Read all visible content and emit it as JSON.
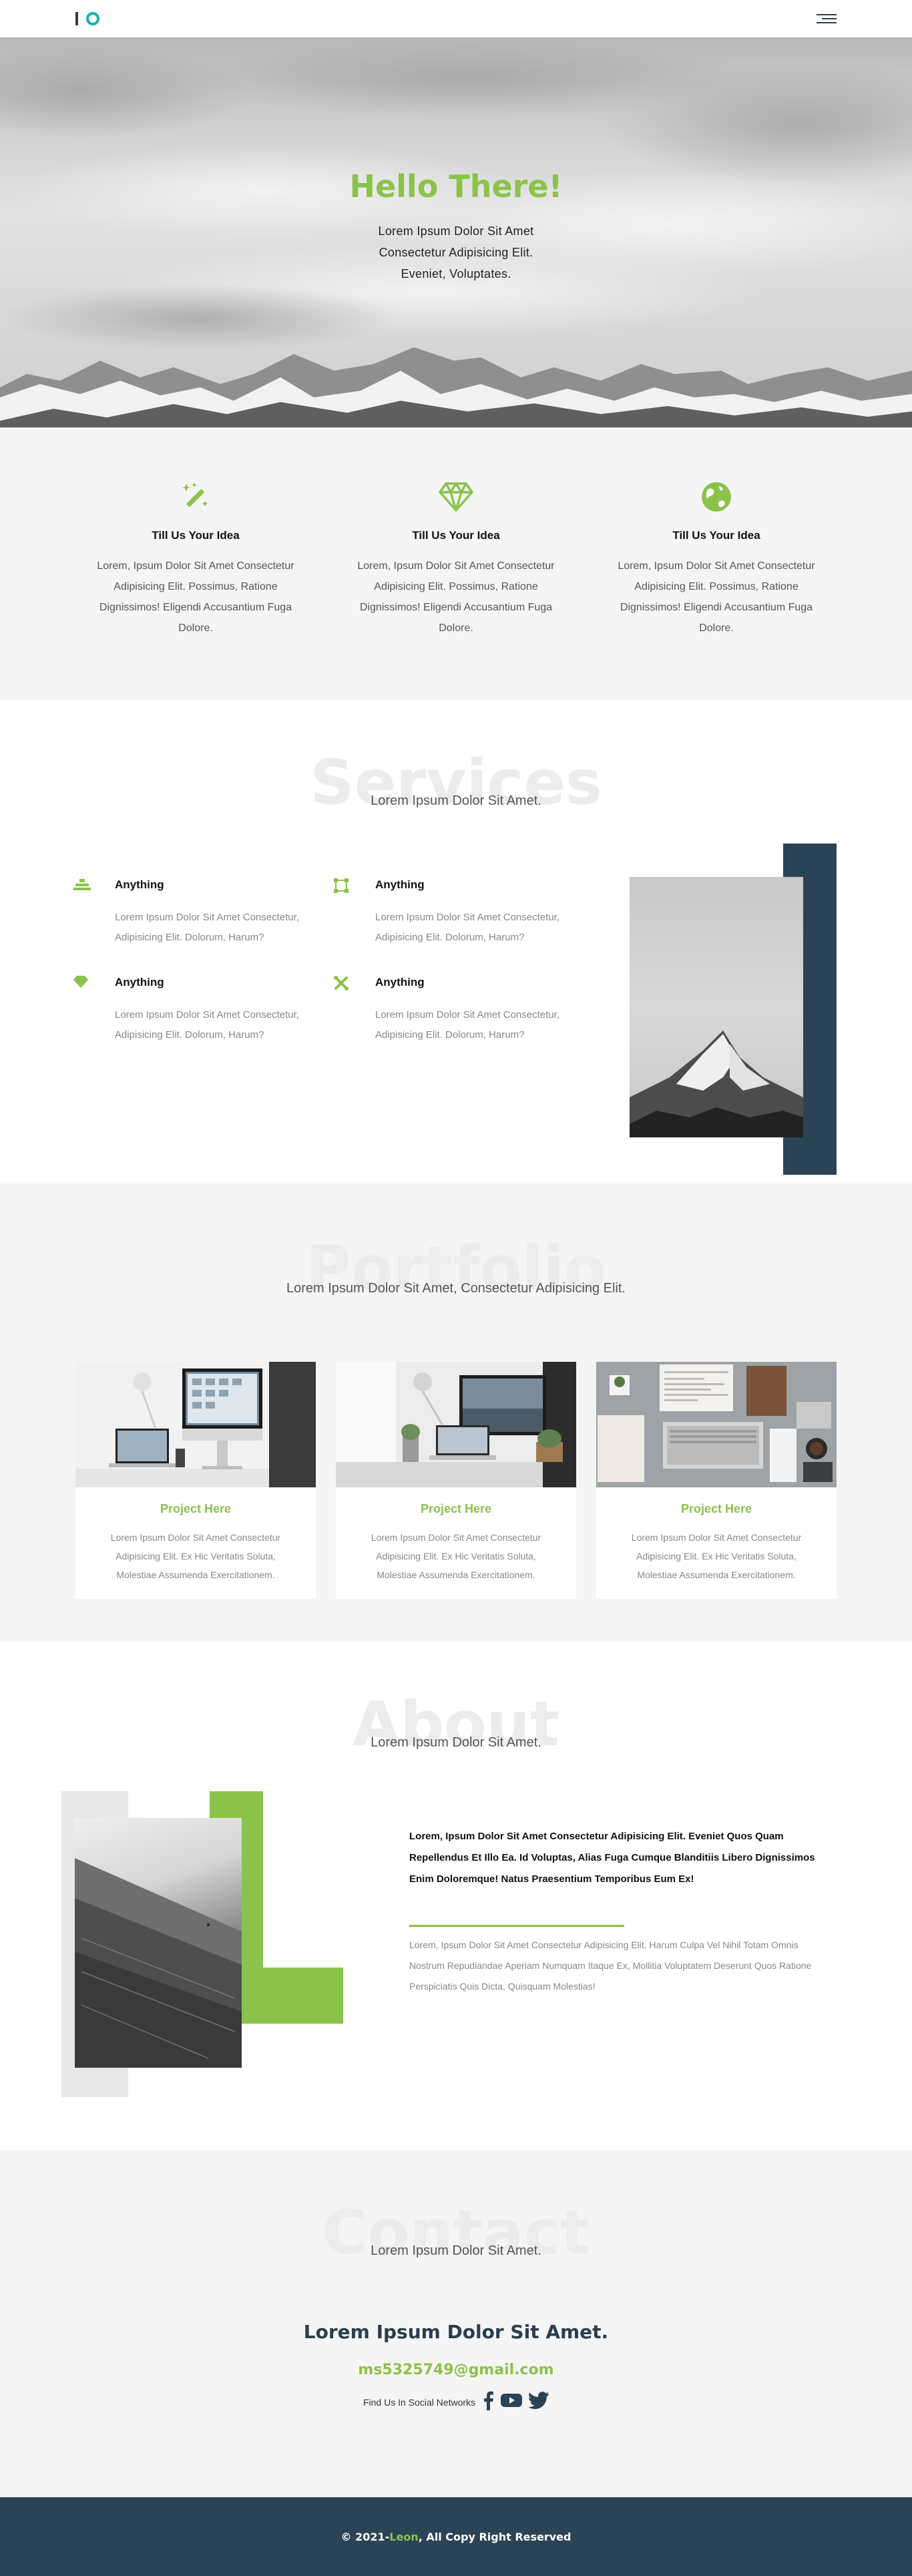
{
  "nav": {
    "logo_icons": [
      "logo-bar-icon",
      "logo-ring-icon"
    ],
    "menu_icon": "hamburger-icon"
  },
  "hero": {
    "title": "Hello There!",
    "text_line1": "Lorem Ipsum Dolor Sit Amet",
    "text_line2": "Consectetur Adipisicing Elit.",
    "text_line3": "Eveniet, Voluptates."
  },
  "features": [
    {
      "icon": "magic-wand-icon",
      "title": "Till Us Your Idea",
      "text": "Lorem, Ipsum Dolor Sit Amet Consectetur Adipisicing Elit. Possimus, Ratione Dignissimos! Eligendi Accusantium Fuga Dolore."
    },
    {
      "icon": "diamond-icon",
      "title": "Till Us Your Idea",
      "text": "Lorem, Ipsum Dolor Sit Amet Consectetur Adipisicing Elit. Possimus, Ratione Dignissimos! Eligendi Accusantium Fuga Dolore."
    },
    {
      "icon": "globe-icon",
      "title": "Till Us Your Idea",
      "text": "Lorem, Ipsum Dolor Sit Amet Consectetur Adipisicing Elit. Possimus, Ratione Dignissimos! Eligendi Accusantium Fuga Dolore."
    }
  ],
  "services": {
    "bg_title": "Services",
    "subtitle": "Lorem Ipsum Dolor Sit Amet.",
    "items": [
      {
        "icon": "layers-icon",
        "title": "Anything",
        "text": "Lorem Ipsum Dolor Sit Amet Consectetur, Adipisicing Elit. Dolorum, Harum?"
      },
      {
        "icon": "vector-square-icon",
        "title": "Anything",
        "text": "Lorem Ipsum Dolor Sit Amet Consectetur, Adipisicing Elit. Dolorum, Harum?"
      },
      {
        "icon": "gem-icon",
        "title": "Anything",
        "text": "Lorem Ipsum Dolor Sit Amet Consectetur, Adipisicing Elit. Dolorum, Harum?"
      },
      {
        "icon": "tools-icon",
        "title": "Anything",
        "text": "Lorem Ipsum Dolor Sit Amet Consectetur, Adipisicing Elit. Dolorum, Harum?"
      }
    ]
  },
  "portfolio": {
    "bg_title": "Portfolio",
    "subtitle": "Lorem Ipsum Dolor Sit Amet, Consectetur Adipisicing Elit.",
    "cards": [
      {
        "title": "Project Here",
        "text": "Lorem Ipsum Dolor Sit Amet Consectetur Adipisicing Elit. Ex Hic Veritatis Soluta, Molestiae Assumenda Exercitationem."
      },
      {
        "title": "Project Here",
        "text": "Lorem Ipsum Dolor Sit Amet Consectetur Adipisicing Elit. Ex Hic Veritatis Soluta, Molestiae Assumenda Exercitationem."
      },
      {
        "title": "Project Here",
        "text": "Lorem Ipsum Dolor Sit Amet Consectetur Adipisicing Elit. Ex Hic Veritatis Soluta, Molestiae Assumenda Exercitationem."
      }
    ]
  },
  "about": {
    "bg_title": "About",
    "subtitle": "Lorem Ipsum Dolor Sit Amet.",
    "bold_text": "Lorem, Ipsum Dolor Sit Amet Consectetur Adipisicing Elit. Eveniet Quos Quam Repellendus Et Illo Ea. Id Voluptas, Alias Fuga Cumque Blanditiis Libero Dignissimos Enim Doloremque! Natus Praesentium Temporibus Eum Ex!",
    "light_text": "Lorem, Ipsum Dolor Sit Amet Consectetur Adipisicing Elit. Harum Culpa Vel Nihil Totam Omnis Nostrum Repudiandae Aperiam Numquam Itaque Ex, Mollitia Voluptatem Deserunt Quos Ratione Perspiciatis Quis Dicta, Quisquam Molestias!"
  },
  "contact": {
    "bg_title": "Contact",
    "subtitle": "Lorem Ipsum Dolor Sit Amet.",
    "title": "Lorem Ipsum Dolor Sit Amet.",
    "email": "ms5325749@gmail.com",
    "social_label": "Find Us In Social Networks",
    "social_icons": [
      "facebook-icon",
      "youtube-icon",
      "twitter-icon"
    ]
  },
  "footer": {
    "prefix": "© 2021-",
    "brand": "Leon",
    "suffix": ", All Copy Right Reserved"
  },
  "colors": {
    "accent_green": "#8bc34a",
    "navy": "#2b4455",
    "teal": "#1ab0b0",
    "section_grey": "#f5f5f5"
  }
}
